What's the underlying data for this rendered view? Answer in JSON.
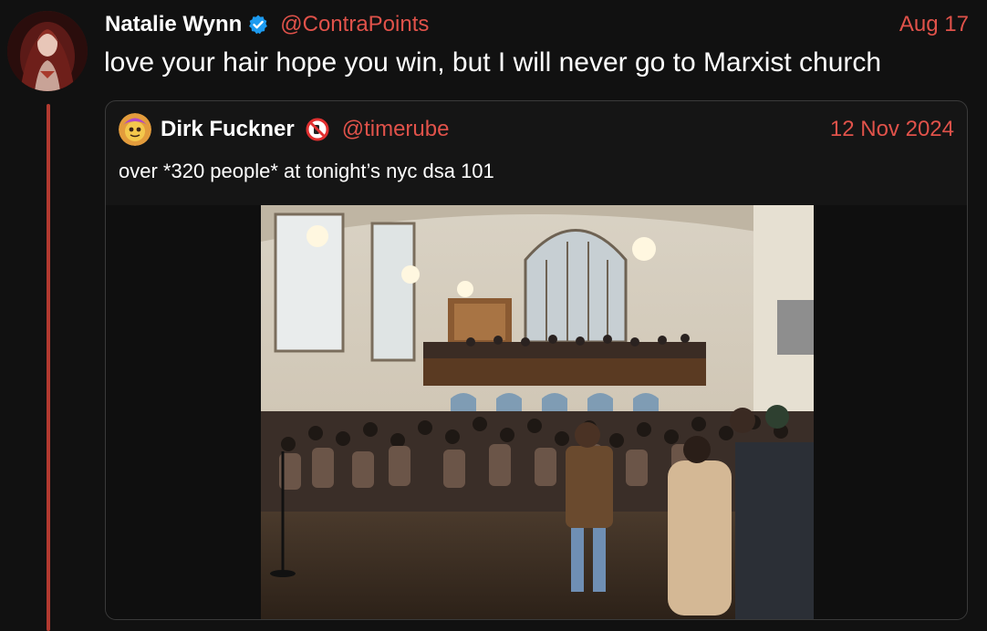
{
  "tweet": {
    "author_name": "Natalie Wynn",
    "author_handle": "@ContraPoints",
    "date": "Aug 17",
    "text": "love your hair hope you win, but I will never go to Marxist church",
    "avatar_icon": "avatar-icon",
    "verified_icon": "verified-badge-icon"
  },
  "quoted_tweet": {
    "author_name": "Dirk Fuckner",
    "author_handle": "@timerube",
    "date": "12 Nov 2024",
    "text": "over *320 people* at tonight’s nyc dsa 101",
    "avatar_icon": "emoji-avatar-icon",
    "badge_icon": "no-symbol-badge-icon",
    "media": {
      "type": "photo",
      "icon": "crowded-hall-photo"
    }
  },
  "colors": {
    "background": "#111111",
    "accent": "#e0524a",
    "thread_line": "#b23a30",
    "card_border": "#3a3a3a",
    "verified": "#1d9bf0"
  }
}
